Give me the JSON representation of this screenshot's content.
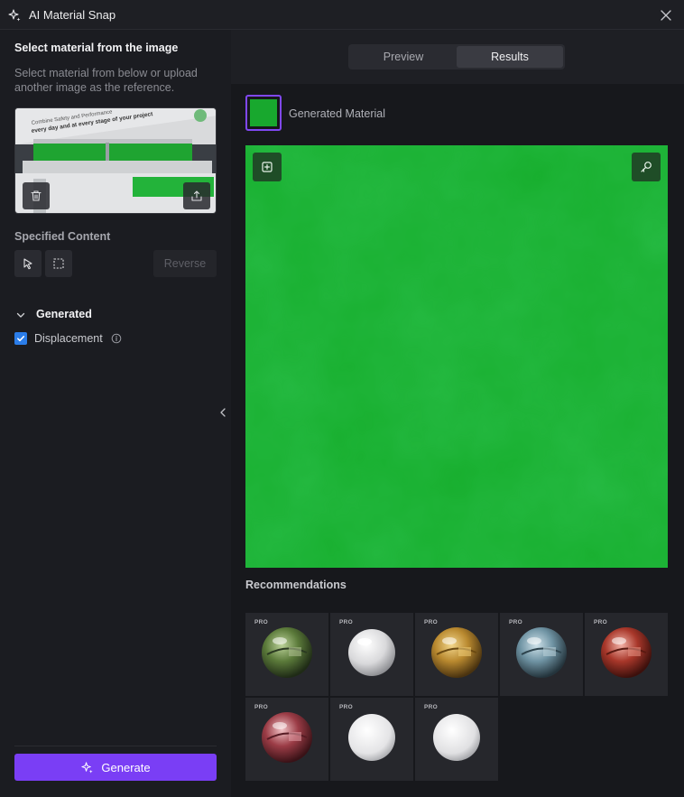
{
  "window": {
    "title": "AI Material Snap"
  },
  "left": {
    "select_title": "Select material from the image",
    "select_desc": "Select material from below or upload another image as the reference.",
    "reference_image": {
      "banner_line1": "Combine Safety and Performance",
      "banner_line2": "every day and at every stage of your project"
    },
    "specified_title": "Specified Content",
    "reverse_label": "Reverse",
    "generated_title": "Generated",
    "displacement_label": "Displacement",
    "generate_label": "Generate"
  },
  "tabs": [
    {
      "label": "Preview",
      "active": false
    },
    {
      "label": "Results",
      "active": true
    }
  ],
  "results": {
    "generated_label": "Generated Material",
    "material_color": "#17ae2d",
    "recommendations_title": "Recommendations",
    "recommendations": [
      {
        "badge": "PRO",
        "kind": "green-glass"
      },
      {
        "badge": "PRO",
        "kind": "white-glossy"
      },
      {
        "badge": "PRO",
        "kind": "gold-glass"
      },
      {
        "badge": "PRO",
        "kind": "blue-glass"
      },
      {
        "badge": "PRO",
        "kind": "red-glass"
      },
      {
        "badge": "PRO",
        "kind": "rose-glass"
      },
      {
        "badge": "PRO",
        "kind": "white-matte"
      },
      {
        "badge": "PRO",
        "kind": "white-matte"
      }
    ]
  },
  "colors": {
    "accent": "#7a3ef5",
    "checkbox": "#2b7de9",
    "selection": "#8048f3"
  }
}
